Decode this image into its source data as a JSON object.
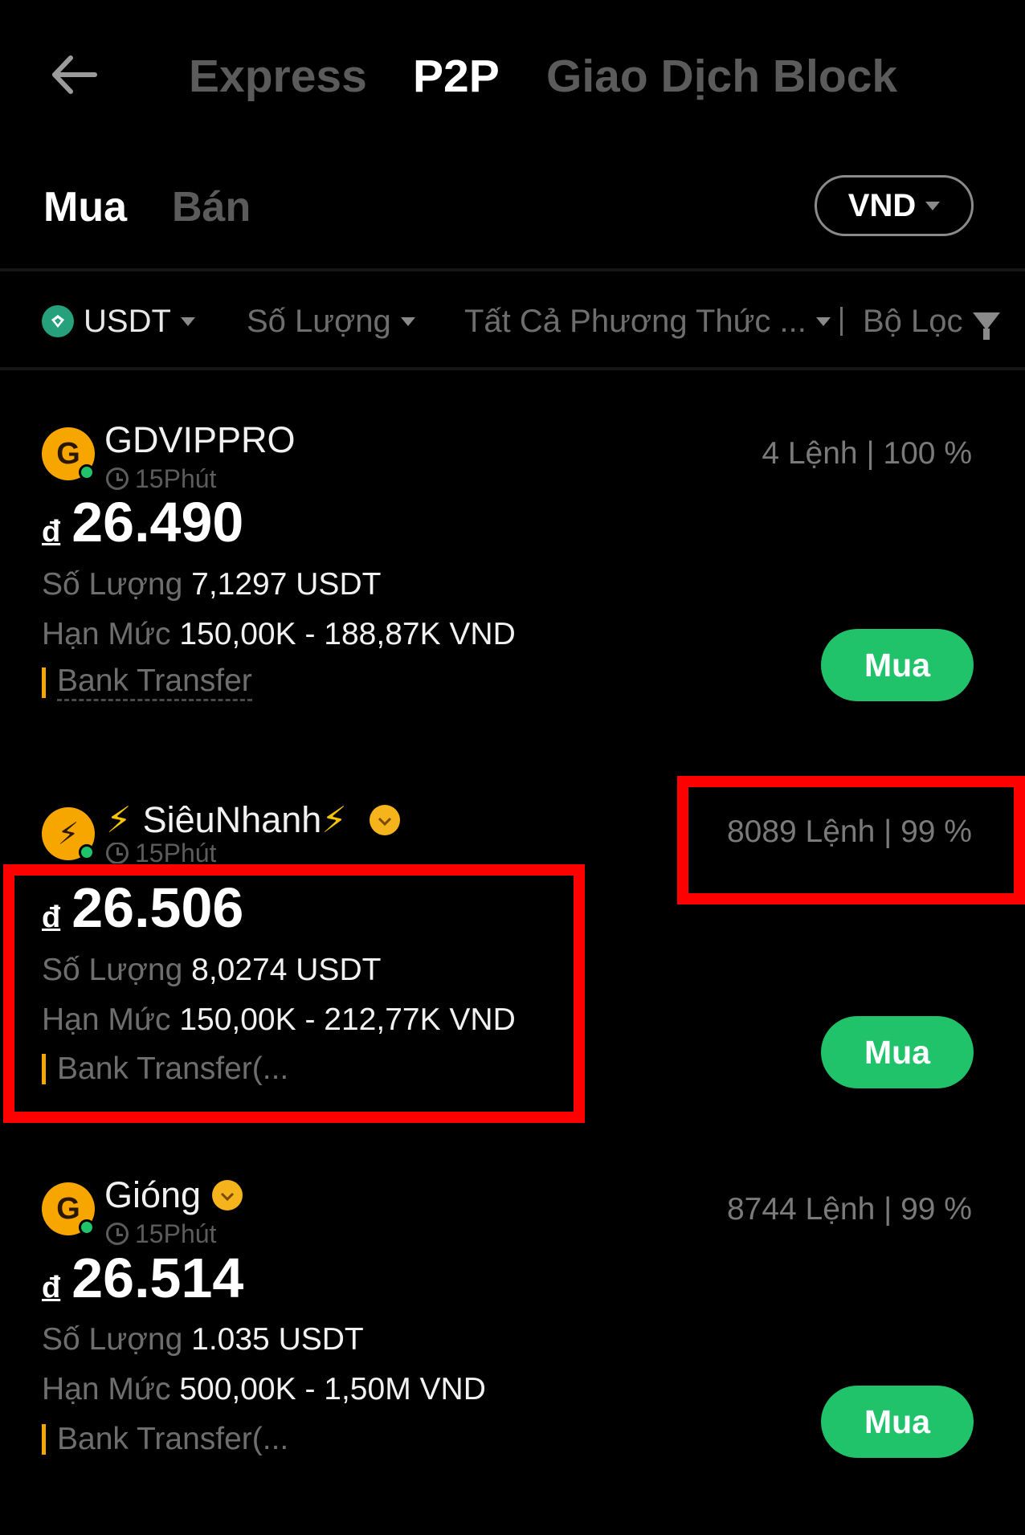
{
  "nav": {
    "tabs": [
      {
        "label": "Express",
        "active": false
      },
      {
        "label": "P2P",
        "active": true
      },
      {
        "label": "Giao Dịch Block",
        "active": false
      }
    ]
  },
  "side_tabs": {
    "buy": "Mua",
    "sell": "Bán",
    "active": "buy"
  },
  "currency": {
    "value": "VND"
  },
  "filters": {
    "asset": "USDT",
    "amount": "Số Lượng",
    "payment": "Tất Cả Phương Thức ...",
    "filter": "Bộ Lọc"
  },
  "listings": [
    {
      "avatar_letter": "G",
      "name": "GDVIPPRO",
      "name_prefix": "",
      "name_suffix": "",
      "verified": false,
      "time": "15Phút",
      "stats": "4 Lệnh | 100 %",
      "currency_symbol": "đ",
      "price": "26.490",
      "quantity_label": "Số Lượng",
      "quantity": "7,1297 USDT",
      "limit_label": "Hạn Mức",
      "limit": "150,00K - 188,87K VND",
      "payment": "Bank Transfer",
      "button": "Mua"
    },
    {
      "avatar_letter": "⚡",
      "name": "SiêuNhanh",
      "name_prefix": "⚡",
      "name_suffix": "⚡",
      "verified": true,
      "time": "15Phút",
      "stats": "8089 Lệnh | 99 %",
      "currency_symbol": "đ",
      "price": "26.506",
      "quantity_label": "Số Lượng",
      "quantity": "8,0274 USDT",
      "limit_label": "Hạn Mức",
      "limit": "150,00K - 212,77K VND",
      "payment": "Bank Transfer(...",
      "button": "Mua"
    },
    {
      "avatar_letter": "G",
      "name": "Gióng",
      "name_prefix": "",
      "name_suffix": "",
      "verified": true,
      "time": "15Phút",
      "stats": "8744 Lệnh | 99 %",
      "currency_symbol": "đ",
      "price": "26.514",
      "quantity_label": "Số Lượng",
      "quantity": "1.035 USDT",
      "limit_label": "Hạn Mức",
      "limit": "500,00K - 1,50M VND",
      "payment": "Bank Transfer(...",
      "button": "Mua"
    }
  ],
  "colors": {
    "background": "#000000",
    "accent_green": "#20c26a",
    "avatar_orange": "#f7a600",
    "highlight_red": "#ff0000",
    "dim_text": "#6e6e6e"
  }
}
